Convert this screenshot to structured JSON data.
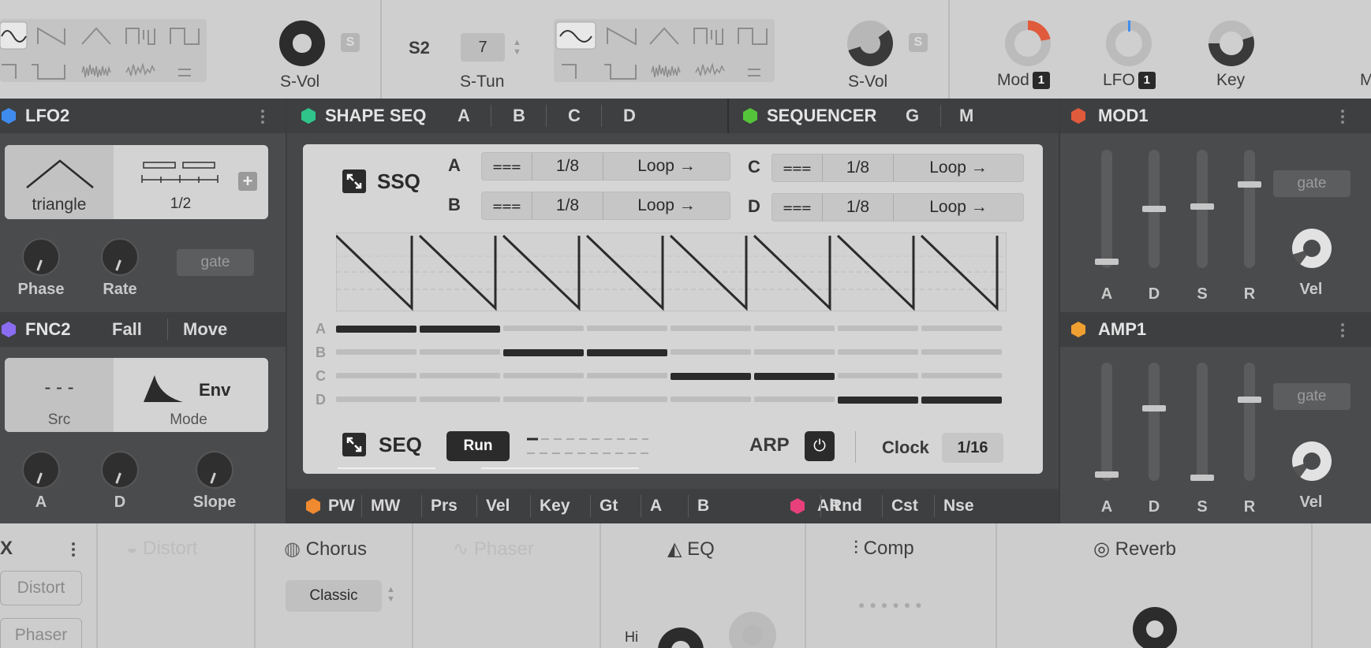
{
  "top": {
    "svol1_label": "S-Vol",
    "s_badge": "S",
    "s2_label": "S2",
    "stun_value": "7",
    "stun_label": "S-Tun",
    "svol2_label": "S-Vol",
    "mod_label": "Mod",
    "mod_badge": "1",
    "lfo_label": "LFO",
    "lfo_badge": "1",
    "key_label": "Key",
    "edge_label": "M"
  },
  "lfo2": {
    "title": "LFO2",
    "shape": "triangle",
    "rate_div": "1/2",
    "knobs": [
      "Phase",
      "Rate"
    ],
    "gate": "gate",
    "hex_color": "#3f8cf0"
  },
  "fnc2": {
    "title": "FNC2",
    "tabs": [
      "Fall",
      "Move"
    ],
    "src_value": "- - -",
    "src_label": "Src",
    "mode_value": "Env",
    "mode_label": "Mode",
    "knobs": [
      "A",
      "D",
      "Slope"
    ],
    "hex_color": "#8a6cf0"
  },
  "shapeseq": {
    "title": "SHAPE SEQ",
    "tabs": [
      "A",
      "B",
      "C",
      "D"
    ],
    "hex_color": "#2fc48a"
  },
  "sequencer": {
    "title": "SEQUENCER",
    "tabs": [
      "G",
      "M"
    ],
    "hex_color": "#55c43a"
  },
  "ssq": {
    "title": "SSQ",
    "rows": [
      {
        "name": "A",
        "rate": "1/8",
        "mode": "Loop →"
      },
      {
        "name": "B",
        "rate": "1/8",
        "mode": "Loop →"
      },
      {
        "name": "C",
        "rate": "1/8",
        "mode": "Loop →"
      },
      {
        "name": "D",
        "rate": "1/8",
        "mode": "Loop →"
      }
    ],
    "lane_labels": [
      "A",
      "B",
      "C",
      "D"
    ],
    "lane_active": [
      [
        0,
        1
      ],
      [
        2,
        3
      ],
      [
        4,
        5
      ],
      [
        6,
        7
      ]
    ],
    "seq_label": "SEQ",
    "run_label": "Run",
    "arp_label": "ARP",
    "clock_label": "Clock",
    "clock_value": "1/16"
  },
  "mod1": {
    "title": "MOD1",
    "sliders": [
      "A",
      "D",
      "S",
      "R"
    ],
    "levels": [
      0.03,
      0.5,
      0.52,
      0.72
    ],
    "gate": "gate",
    "vel": "Vel",
    "hex_color": "#e05a3c"
  },
  "amp1": {
    "title": "AMP1",
    "sliders": [
      "A",
      "D",
      "S",
      "R"
    ],
    "levels": [
      0.03,
      0.62,
      0.0,
      0.7
    ],
    "gate": "gate",
    "vel": "Vel",
    "hex_color": "#f0a030"
  },
  "modstrip": {
    "tabs": [
      "PW",
      "MW",
      "Prs",
      "Vel",
      "Key",
      "Gt",
      "A",
      "B",
      "Alt",
      "Rnd",
      "Cst",
      "Nse"
    ],
    "pw_hex": "#f08a30",
    "alt_hex": "#e8407a"
  },
  "fx": {
    "x_label": "X",
    "distort_btn": "Distort",
    "phaser_btn": "Phaser",
    "distort": "Distort",
    "chorus": "Chorus",
    "chorus_mode": "Classic",
    "phaser": "Phaser",
    "eq": "EQ",
    "eq_hi": "Hi",
    "comp": "Comp",
    "reverb": "Reverb"
  }
}
